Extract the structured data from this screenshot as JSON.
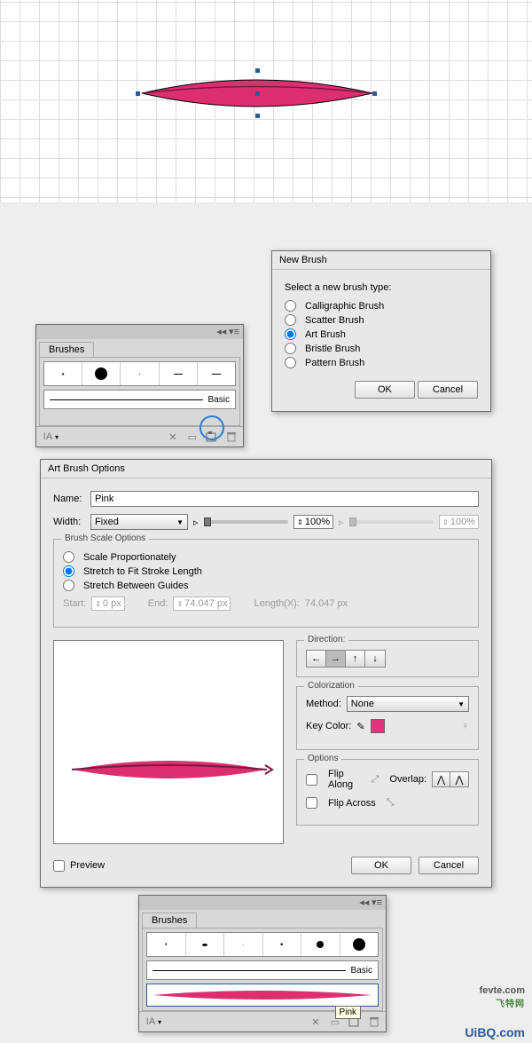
{
  "canvas": {
    "shape_color": "#dd2f6f"
  },
  "brushes_panel_1": {
    "title": "Brushes",
    "basic_label": "Basic",
    "menu_icon": "IA"
  },
  "new_brush_dialog": {
    "title": "New Brush",
    "prompt": "Select a new brush type:",
    "options": [
      "Calligraphic Brush",
      "Scatter Brush",
      "Art Brush",
      "Bristle Brush",
      "Pattern Brush"
    ],
    "selected_index": 2,
    "ok": "OK",
    "cancel": "Cancel"
  },
  "art_brush_options": {
    "title": "Art Brush Options",
    "name_label": "Name:",
    "name_value": "Pink",
    "width_label": "Width:",
    "width_mode": "Fixed",
    "width_value_1": "100%",
    "width_value_2": "100%",
    "scale_legend": "Brush Scale Options",
    "scale_opts": [
      "Scale Proportionately",
      "Stretch to Fit Stroke Length",
      "Stretch Between Guides"
    ],
    "scale_selected": 1,
    "start_label": "Start:",
    "start_value": "0 px",
    "end_label": "End:",
    "end_value": "74.047 px",
    "length_label": "Length(X):",
    "length_value": "74.047 px",
    "direction_label": "Direction:",
    "colorization_label": "Colorization",
    "method_label": "Method:",
    "method_value": "None",
    "keycolor_label": "Key Color:",
    "options_label": "Options",
    "flip_along": "Flip Along",
    "flip_across": "Flip Across",
    "overlap_label": "Overlap:",
    "preview_label": "Preview",
    "ok": "OK",
    "cancel": "Cancel"
  },
  "brushes_panel_2": {
    "title": "Brushes",
    "basic_label": "Basic",
    "tooltip": "Pink"
  },
  "watermark": {
    "brand": "fevte",
    "domain": ".com",
    "green": "飞特网",
    "bottom": "UiBQ.com"
  }
}
